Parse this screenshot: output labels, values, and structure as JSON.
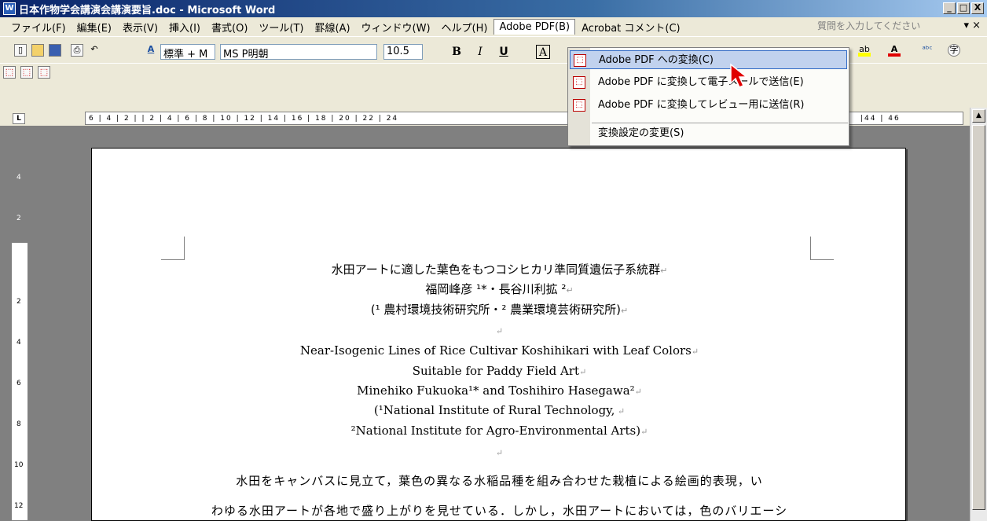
{
  "window": {
    "title": "日本作物学会講演会講演要旨.doc - Microsoft Word",
    "min": "_",
    "max": "□",
    "close": "X"
  },
  "menu": {
    "items": [
      "ファイル(F)",
      "編集(E)",
      "表示(V)",
      "挿入(I)",
      "書式(O)",
      "ツール(T)",
      "罫線(A)",
      "ウィンドウ(W)",
      "ヘルプ(H)",
      "Adobe PDF(B)",
      "Acrobat コメント(C)"
    ],
    "help_placeholder": "質問を入力してください",
    "close_doc": "▾ ×"
  },
  "toolbar": {
    "style": "標準 + M",
    "font": "MS P明朝",
    "size": "10.5",
    "bold": "B",
    "italic": "I",
    "underline": "U",
    "boxed": "A"
  },
  "ruler": {
    "text": "6 | 4 | 2 | | 2 | 4 | 6 | 8 | 10 | 12 | 14 | 16 | 18 | 20 | 22 | 24",
    "right_text": "|44 | 46",
    "tab_selector": "L"
  },
  "vruler": {
    "labels": [
      "4",
      "2",
      "2",
      "4",
      "6",
      "8",
      "10",
      "12"
    ]
  },
  "dropdown": {
    "items": [
      {
        "label": "Adobe PDF への変換(C)",
        "highlighted": true
      },
      {
        "label": "Adobe PDF に変換して電子メールで送信(E)",
        "highlighted": false
      },
      {
        "label": "Adobe PDF に変換してレビュー用に送信(R)",
        "highlighted": false
      },
      {
        "label": "変換設定の変更(S)",
        "highlighted": false
      }
    ]
  },
  "document": {
    "jp_title": "水田アートに適した葉色をもつコシヒカリ準同質遺伝子系統群",
    "jp_authors": "福岡峰彦 ¹*・長谷川利拡 ²",
    "jp_affil": "(¹ 農村環境技術研究所・² 農業環境芸術研究所)",
    "en_title_1": "Near-Isogenic Lines of Rice Cultivar Koshihikari with Leaf Colors",
    "en_title_2": "Suitable for Paddy Field Art",
    "en_authors": "Minehiko Fukuoka¹* and Toshihiro Hasegawa²",
    "en_affil_1": "(¹National Institute of Rural Technology,",
    "en_affil_2": "²National Institute for Agro-Environmental Arts)",
    "body_1": "水田をキャンバスに見立て，葉色の異なる水稲品種を組み合わせた栽植による絵画的表現，い",
    "body_2": "わゆる水田アートが各地で盛り上がりを見せている．しかし，水田アートにおいては，色のバリエーシ"
  },
  "colors": {
    "titlebar": "#0a246a",
    "menu_bg": "#ece9d8",
    "highlight": "#c1d2ee",
    "cursor": "#e00000"
  }
}
